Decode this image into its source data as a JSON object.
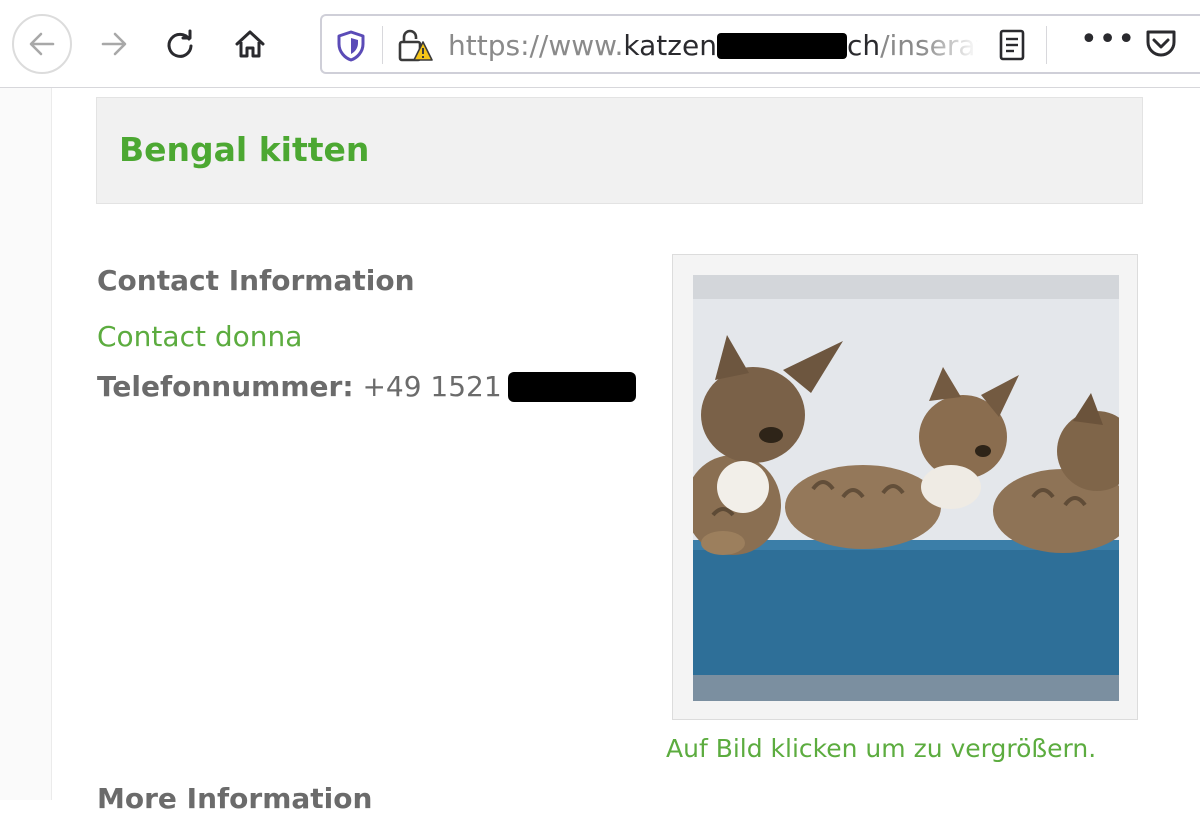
{
  "browser": {
    "url_prefix": "https://www.",
    "url_host_start": "katzen",
    "url_host_end": "ch",
    "url_path": "/inserat-a"
  },
  "listing": {
    "title": "Bengal kitten",
    "contact_heading": "Contact Information",
    "contact_link": "Contact donna",
    "phone_label": "Telefonnummer:",
    "phone_value": "+49 1521",
    "image_caption": "Auf Bild klicken um zu vergrößern.",
    "more_heading": "More Information"
  },
  "colors": {
    "accent_green": "#4ca832",
    "link_green": "#5cac3f",
    "text_gray": "#6b6b6b"
  },
  "icons": [
    "back-icon",
    "forward-icon",
    "reload-icon",
    "home-icon",
    "tracking-shield-icon",
    "insecure-lock-icon",
    "reader-view-icon",
    "more-actions-icon",
    "pocket-icon"
  ]
}
